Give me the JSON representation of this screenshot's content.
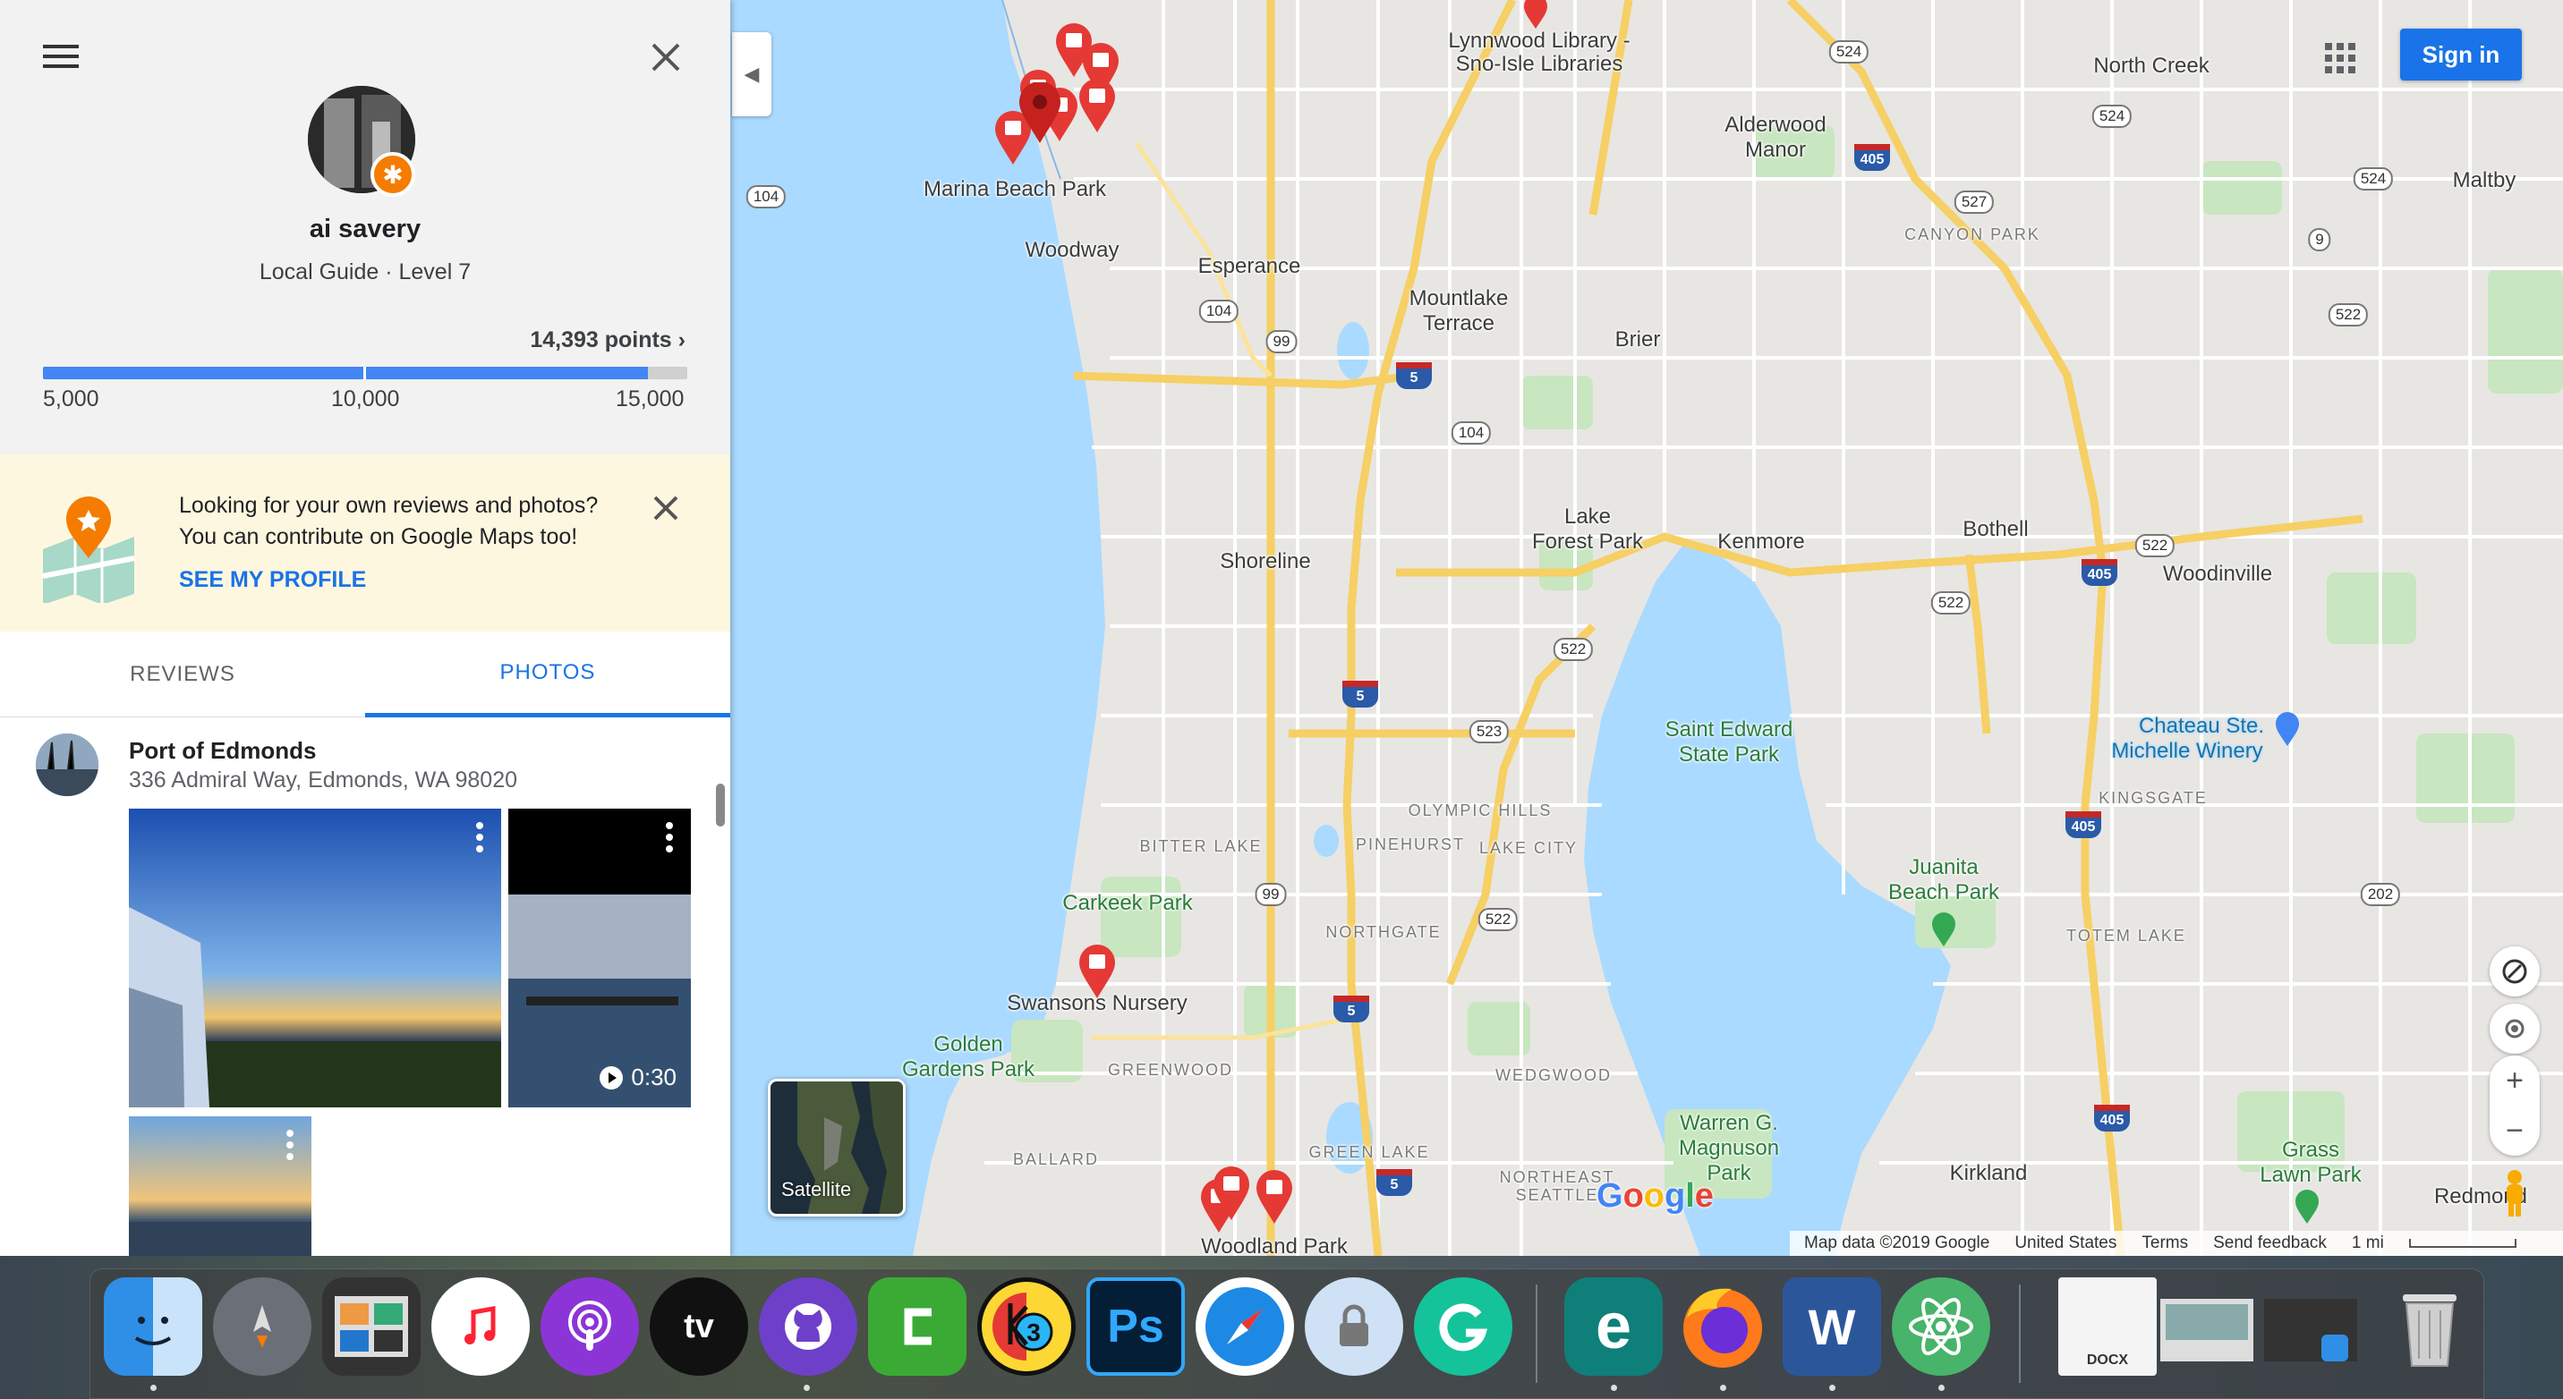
{
  "profile": {
    "name": "ai savery",
    "level": "Local Guide · Level 7",
    "points": "14,393 points",
    "progress_fraction": 0.939,
    "ticks": [
      "5,000",
      "10,000",
      "15,000"
    ]
  },
  "promo": {
    "line1": "Looking for your own reviews and photos?",
    "line2": "You can contribute on Google Maps too!",
    "link": "SEE MY PROFILE"
  },
  "tabs": {
    "reviews": "REVIEWS",
    "photos": "PHOTOS"
  },
  "place": {
    "name": "Port of Edmonds",
    "address": "336 Admiral Way, Edmonds, WA 98020",
    "video_duration": "0:30"
  },
  "map": {
    "signin": "Sign in",
    "satellite": "Satellite",
    "logo": "Google",
    "footer": {
      "data": "Map data ©2019 Google",
      "country": "United States",
      "terms": "Terms",
      "feedback": "Send feedback",
      "scale": "1 mi"
    },
    "places": {
      "lynnwood_library": "Lynnwood Library -",
      "sno_isle": "Sno-Isle Libraries",
      "north_creek": "North Creek",
      "alderwood1": "Alderwood",
      "alderwood2": "Manor",
      "maltby": "Maltby",
      "marina_beach": "Marina Beach Park",
      "woodway": "Woodway",
      "esperance": "Esperance",
      "mountlake1": "Mountlake",
      "mountlake2": "Terrace",
      "brier": "Brier",
      "canyon_park": "CANYON PARK",
      "shoreline": "Shoreline",
      "lake_forest1": "Lake",
      "lake_forest2": "Forest Park",
      "kenmore": "Kenmore",
      "bothell": "Bothell",
      "woodinville": "Woodinville",
      "saint_edward1": "Saint Edward",
      "saint_edward2": "State Park",
      "chateau1": "Chateau Ste.",
      "chateau2": "Michelle Winery",
      "kingsgate": "KINGSGATE",
      "olympic_hills": "OLYMPIC HILLS",
      "bitter_lake": "BITTER LAKE",
      "pinehurst": "PINEHURST",
      "lake_city": "LAKE CITY",
      "carkeek": "Carkeek Park",
      "juanita1": "Juanita",
      "juanita2": "Beach Park",
      "northgate": "NORTHGATE",
      "totem_lake": "TOTEM LAKE",
      "swansons": "Swansons Nursery",
      "golden1": "Golden",
      "golden2": "Gardens Park",
      "greenwood": "GREENWOOD",
      "wedgwood": "WEDGWOOD",
      "warren1": "Warren G.",
      "warren2": "Magnuson",
      "warren3": "Park",
      "ballard": "BALLARD",
      "green_lake": "GREEN LAKE",
      "ne_seattle1": "NORTHEAST",
      "ne_seattle2": "SEATTLE",
      "kirkland": "Kirkland",
      "grass1": "Grass",
      "grass2": "Lawn Park",
      "redmond": "Redmond",
      "woodland": "Woodland Park"
    },
    "shields": {
      "s104a": "104",
      "s524a": "524",
      "s524b": "524",
      "s524c": "524",
      "s527": "527",
      "s9": "9",
      "s104b": "104",
      "s99a": "99",
      "s104c": "104",
      "s522a": "522",
      "s522b": "522",
      "s522c": "522",
      "s522d": "522",
      "s523": "523",
      "s99b": "99",
      "s522e": "522",
      "s202": "202",
      "i405a": "405",
      "i405b": "405",
      "i405c": "405",
      "i405d": "405",
      "i5a": "5",
      "i5b": "5",
      "i5c": "5",
      "i5d": "5"
    }
  },
  "dock": {
    "apps": [
      "finder-icon",
      "launchpad-icon",
      "photo-browser-icon",
      "itunes-icon",
      "podcasts-icon",
      "apple-tv-icon",
      "github-desktop-icon",
      "camtasia-icon",
      "k3-icon",
      "photoshop-icon",
      "safari-icon",
      "lock-icon",
      "grammarly-icon",
      "eset-icon",
      "firefox-icon",
      "word-icon",
      "atom-icon",
      "document-icon",
      "screenshot-icon",
      "trash-icon"
    ],
    "photoshop_label": "Ps",
    "word_label": "W",
    "eset_label": "e",
    "tv_label": "tv",
    "docx_label": "DOCX"
  }
}
